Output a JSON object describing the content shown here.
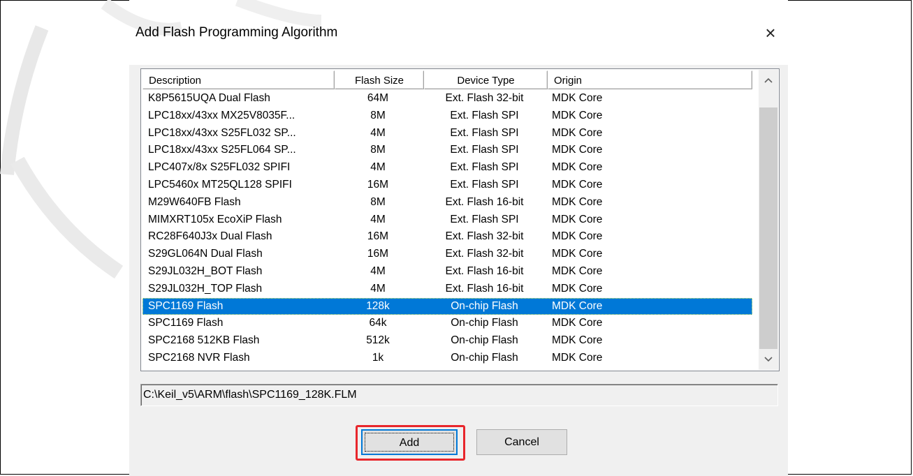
{
  "dialog": {
    "title": "Add Flash Programming Algorithm",
    "close_symbol": "×"
  },
  "list": {
    "columns": [
      "Description",
      "Flash Size",
      "Device Type",
      "Origin"
    ],
    "rows": [
      [
        "K8P5615UQA Dual Flash",
        "64M",
        "Ext. Flash 32-bit",
        "MDK Core"
      ],
      [
        "LPC18xx/43xx MX25V8035F...",
        "8M",
        "Ext. Flash SPI",
        "MDK Core"
      ],
      [
        "LPC18xx/43xx S25FL032 SP...",
        "4M",
        "Ext. Flash SPI",
        "MDK Core"
      ],
      [
        "LPC18xx/43xx S25FL064 SP...",
        "8M",
        "Ext. Flash SPI",
        "MDK Core"
      ],
      [
        "LPC407x/8x S25FL032 SPIFI",
        "4M",
        "Ext. Flash SPI",
        "MDK Core"
      ],
      [
        "LPC5460x MT25QL128 SPIFI",
        "16M",
        "Ext. Flash SPI",
        "MDK Core"
      ],
      [
        "M29W640FB Flash",
        "8M",
        "Ext. Flash 16-bit",
        "MDK Core"
      ],
      [
        "MIMXRT105x EcoXiP Flash",
        "4M",
        "Ext. Flash SPI",
        "MDK Core"
      ],
      [
        "RC28F640J3x Dual Flash",
        "16M",
        "Ext. Flash 32-bit",
        "MDK Core"
      ],
      [
        "S29GL064N Dual Flash",
        "16M",
        "Ext. Flash 32-bit",
        "MDK Core"
      ],
      [
        "S29JL032H_BOT Flash",
        "4M",
        "Ext. Flash 16-bit",
        "MDK Core"
      ],
      [
        "S29JL032H_TOP Flash",
        "4M",
        "Ext. Flash 16-bit",
        "MDK Core"
      ],
      [
        "SPC1169 Flash",
        "128k",
        "On-chip Flash",
        "MDK Core"
      ],
      [
        "SPC1169 Flash",
        "64k",
        "On-chip Flash",
        "MDK Core"
      ],
      [
        "SPC2168 512KB Flash",
        "512k",
        "On-chip Flash",
        "MDK Core"
      ],
      [
        "SPC2168 NVR Flash",
        "1k",
        "On-chip Flash",
        "MDK Core"
      ]
    ],
    "selected_index": 12,
    "scroll_up_icon": "chevron-up-icon",
    "scroll_down_icon": "chevron-down-icon"
  },
  "path_field": {
    "value": "C:\\Keil_v5\\ARM\\flash\\SPC1169_128K.FLM"
  },
  "buttons": {
    "add_label": "Add",
    "cancel_label": "Cancel"
  },
  "colors": {
    "selection": "#0078d7",
    "highlight_box": "#e8262c",
    "dialog_bg": "#f0f0f0"
  }
}
